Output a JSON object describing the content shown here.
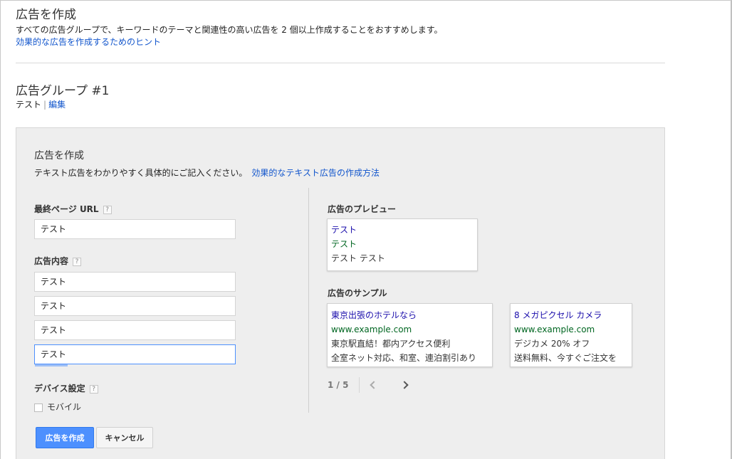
{
  "header": {
    "title": "広告を作成",
    "description": "すべての広告グループで、キーワードのテーマと関連性の高い広告を 2 個以上作成することをおすすめします。",
    "hint_link": "効果的な広告を作成するためのヒント"
  },
  "ad_group": {
    "title": "広告グループ #1",
    "name": "テスト",
    "edit_link": "編集"
  },
  "form": {
    "title": "広告を作成",
    "description": "テキスト広告をわかりやすく具体的にご記入ください。",
    "description_link": "効果的なテキスト広告の作成方法",
    "help_glyph": "?",
    "final_url": {
      "label": "最終ページ URL",
      "value": "テスト"
    },
    "ad_content": {
      "label": "広告内容",
      "lines": [
        "テスト",
        "テスト",
        "テスト",
        "テスト"
      ]
    },
    "device": {
      "label": "デバイス設定",
      "mobile_label": "モバイル",
      "mobile_checked": false
    },
    "buttons": {
      "create": "広告を作成",
      "cancel": "キャンセル"
    }
  },
  "preview": {
    "label": "広告のプレビュー",
    "title": "テスト",
    "url": "テスト",
    "text": "テスト テスト"
  },
  "samples": {
    "label": "広告のサンプル",
    "items": [
      {
        "title": "東京出張のホテルなら",
        "url": "www.example.com",
        "line1": "東京駅直結！都内アクセス便利",
        "line2": "全室ネット対応、和室、連泊割引あり"
      },
      {
        "title": "8 メガピクセル カメラ",
        "url": "www.example.com",
        "line1": "デジカメ 20% オフ",
        "line2": "送料無料、今すぐご注文を"
      }
    ],
    "pager": "1 / 5"
  },
  "colors": {
    "link": "#1155cc",
    "ad_title": "#1a0dab",
    "ad_url": "#006621",
    "primary_button": "#4d90fe",
    "panel_bg": "#eeeeee"
  }
}
